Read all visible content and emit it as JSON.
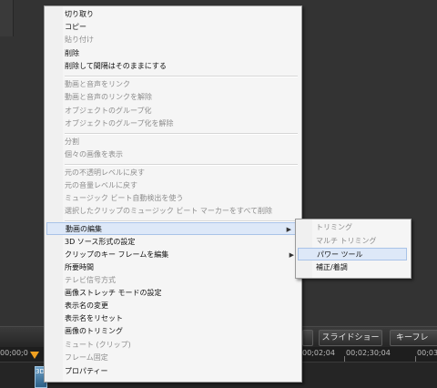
{
  "context_menu": {
    "items": [
      {
        "label": "切り取り",
        "disabled": false
      },
      {
        "label": "コピー",
        "disabled": false
      },
      {
        "label": "貼り付け",
        "disabled": true
      },
      {
        "label": "削除",
        "disabled": false
      },
      {
        "label": "削除して間隔はそのままにする",
        "disabled": false
      },
      {
        "label": "動画と音声をリンク",
        "disabled": true
      },
      {
        "label": "動画と音声のリンクを解除",
        "disabled": true
      },
      {
        "label": "オブジェクトのグループ化",
        "disabled": true
      },
      {
        "label": "オブジェクトのグループ化を解除",
        "disabled": true
      },
      {
        "label": "分割",
        "disabled": true
      },
      {
        "label": "個々の画像を表示",
        "disabled": true
      },
      {
        "label": "元の不透明レベルに戻す",
        "disabled": true
      },
      {
        "label": "元の音量レベルに戻す",
        "disabled": true
      },
      {
        "label": "ミュージック ビート自動検出を使う",
        "disabled": true
      },
      {
        "label": "選択したクリップのミュージック ビート マーカーをすべて削除",
        "disabled": true
      },
      {
        "label": "動画の編集",
        "disabled": false,
        "submenu": true,
        "highlighted": true
      },
      {
        "label": "3D ソース形式の設定",
        "disabled": false
      },
      {
        "label": "クリップのキー フレームを編集",
        "disabled": false,
        "submenu": true
      },
      {
        "label": "所要時間",
        "disabled": false
      },
      {
        "label": "テレビ信号方式",
        "disabled": true
      },
      {
        "label": "画像ストレッチ モードの設定",
        "disabled": false
      },
      {
        "label": "表示名の変更",
        "disabled": false
      },
      {
        "label": "表示名をリセット",
        "disabled": false
      },
      {
        "label": "画像のトリミング",
        "disabled": false
      },
      {
        "label": "ミュート (クリップ)",
        "disabled": true
      },
      {
        "label": "フレーム固定",
        "disabled": true
      },
      {
        "label": "プロパティー",
        "disabled": false
      }
    ],
    "submenu_arrow": "▶"
  },
  "submenu": {
    "items": [
      {
        "label": "トリミング",
        "disabled": true
      },
      {
        "label": "マルチ トリミング",
        "disabled": true
      },
      {
        "label": "パワー ツール",
        "disabled": false,
        "highlighted": true
      },
      {
        "label": "補正/着調",
        "disabled": false
      }
    ]
  },
  "toolbar": {
    "slideshow_label": "スライドショー",
    "keyframe_label": "キーフレ"
  },
  "timeline": {
    "timecodes": [
      "00;00;0",
      "00;02;04",
      "00;02;30;04",
      "00;03"
    ],
    "clip_label": "3D"
  }
}
